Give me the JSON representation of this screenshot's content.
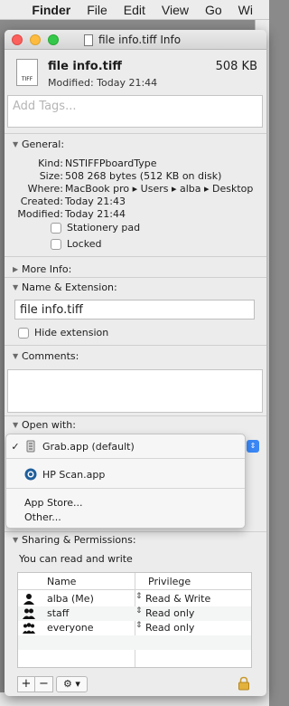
{
  "menubar": {
    "items": [
      "Finder",
      "File",
      "Edit",
      "View",
      "Go",
      "Wi"
    ]
  },
  "window": {
    "title": "file info.tiff Info"
  },
  "file": {
    "icon_label": "TIFF",
    "name": "file info.tiff",
    "size": "508 KB",
    "modified": "Modified: Today 21:44"
  },
  "tags": {
    "placeholder": "Add Tags..."
  },
  "general": {
    "header": "General:",
    "rows": [
      {
        "k": "Kind:",
        "v": "NSTIFFPboardType"
      },
      {
        "k": "Size:",
        "v": "508 268 bytes (512 KB on disk)"
      },
      {
        "k": "Where:",
        "v": "MacBook pro ▸ Users ▸ alba ▸ Desktop"
      },
      {
        "k": "Created:",
        "v": "Today 21:43"
      },
      {
        "k": "Modified:",
        "v": "Today 21:44"
      }
    ],
    "stationery": "Stationery pad",
    "locked": "Locked"
  },
  "more_info": {
    "header": "More Info:"
  },
  "name_ext": {
    "header": "Name & Extension:",
    "value": "file info.tiff",
    "hide_ext": "Hide extension"
  },
  "comments": {
    "header": "Comments:"
  },
  "open_with": {
    "header": "Open with:",
    "options": [
      {
        "check": "✓",
        "label": "Grab.app (default)"
      },
      {
        "check": "",
        "label": "HP Scan.app"
      },
      {
        "check": "",
        "label": "App Store..."
      },
      {
        "check": "",
        "label": "Other..."
      }
    ]
  },
  "sharing": {
    "header": "Sharing & Permissions:",
    "summary": "You can read and write",
    "col_name": "Name",
    "col_priv": "Privilege",
    "rows": [
      {
        "name": "alba (Me)",
        "priv": "Read & Write",
        "icon": "user-icon"
      },
      {
        "name": "staff",
        "priv": "Read only",
        "icon": "group-icon"
      },
      {
        "name": "everyone",
        "priv": "Read only",
        "icon": "everyone-icon"
      }
    ],
    "add": "+",
    "remove": "−",
    "gear": "⚙ ▾"
  }
}
